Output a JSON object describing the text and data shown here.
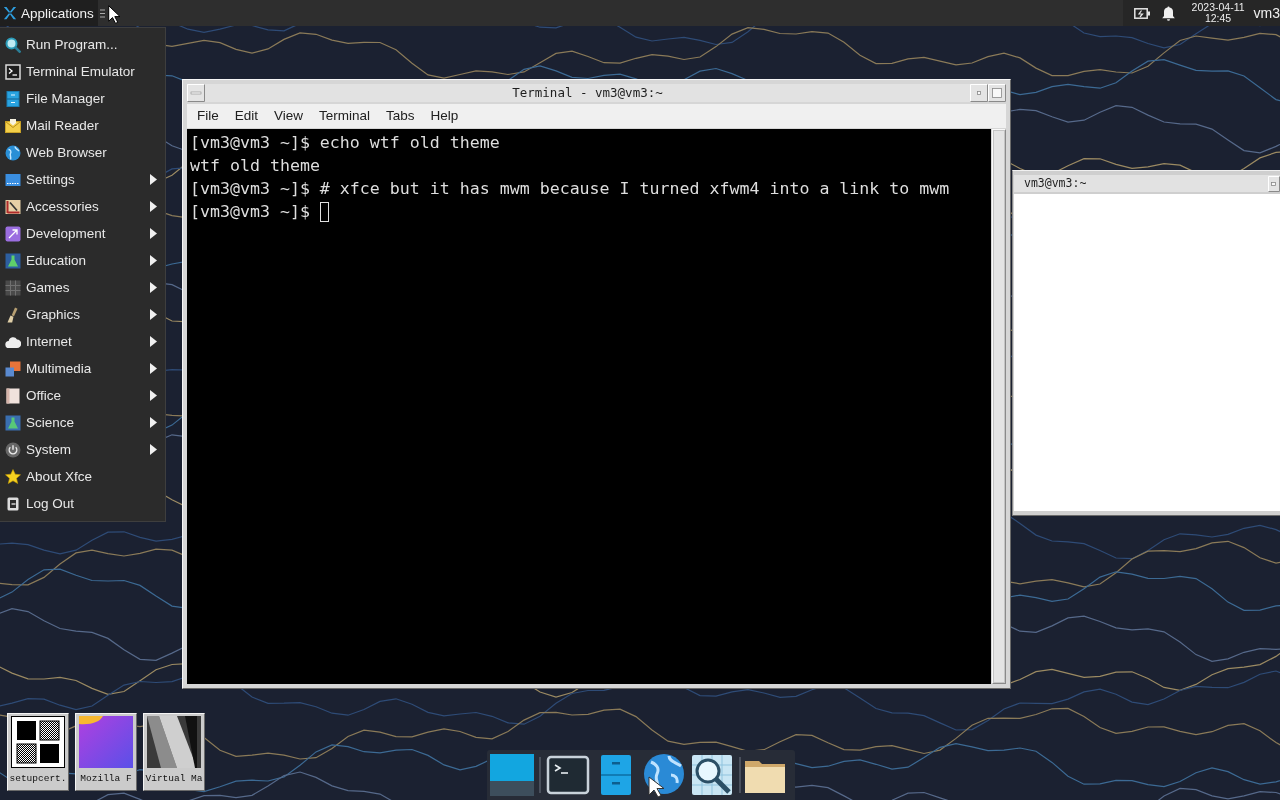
{
  "top_panel": {
    "applications_button": "Applications",
    "clock": {
      "date": "2023-04-11",
      "time": "12:45"
    },
    "user": "vm3"
  },
  "app_menu": {
    "items": [
      {
        "label": "Run Program...",
        "kind": "launcher"
      },
      {
        "label": "Terminal Emulator",
        "kind": "launcher"
      },
      {
        "label": "File Manager",
        "kind": "launcher"
      },
      {
        "label": "Mail Reader",
        "kind": "launcher"
      },
      {
        "label": "Web Browser",
        "kind": "launcher"
      },
      {
        "label": "Settings",
        "kind": "submenu"
      },
      {
        "label": "Accessories",
        "kind": "submenu"
      },
      {
        "label": "Development",
        "kind": "submenu"
      },
      {
        "label": "Education",
        "kind": "submenu"
      },
      {
        "label": "Games",
        "kind": "submenu"
      },
      {
        "label": "Graphics",
        "kind": "submenu"
      },
      {
        "label": "Internet",
        "kind": "submenu"
      },
      {
        "label": "Multimedia",
        "kind": "submenu"
      },
      {
        "label": "Office",
        "kind": "submenu"
      },
      {
        "label": "Science",
        "kind": "submenu"
      },
      {
        "label": "System",
        "kind": "submenu"
      },
      {
        "label": "About Xfce",
        "kind": "launcher"
      },
      {
        "label": "Log Out",
        "kind": "launcher"
      }
    ]
  },
  "terminal_window": {
    "title": "Terminal - vm3@vm3:~",
    "menu": [
      "File",
      "Edit",
      "View",
      "Terminal",
      "Tabs",
      "Help"
    ],
    "lines": [
      {
        "text": "[vm3@vm3 ~]$ echo wtf old theme",
        "cursor": false
      },
      {
        "text": "wtf old theme",
        "cursor": false
      },
      {
        "text": "[vm3@vm3 ~]$ # xfce but it has mwm because I turned xfwm4 into a link to mwm",
        "cursor": false
      },
      {
        "text": "[vm3@vm3 ~]$",
        "cursor": true
      }
    ]
  },
  "background_window": {
    "title": "vm3@vm3:~"
  },
  "iconified_windows": [
    {
      "label": "setupcert."
    },
    {
      "label": "Mozilla F"
    },
    {
      "label": "Virtual Ma"
    }
  ]
}
